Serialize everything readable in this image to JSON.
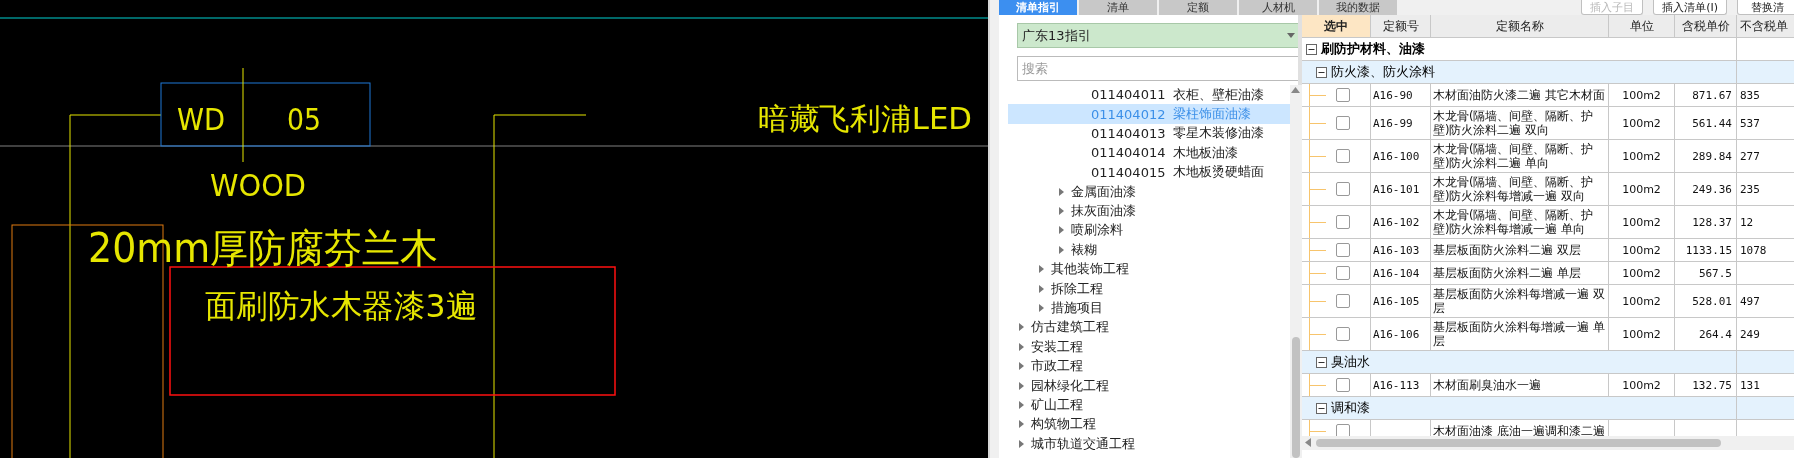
{
  "cad_drawing": {
    "labels": [
      "WD",
      "05",
      "WOOD",
      "20mm厚防腐芬兰木",
      "面刷防水木器漆3遍",
      "暗藏飞利浦LED"
    ]
  },
  "tabs": [
    {
      "label": "清单指引",
      "selected": true
    },
    {
      "label": "清单",
      "selected": false
    },
    {
      "label": "定额",
      "selected": false
    },
    {
      "label": "人材机",
      "selected": false
    },
    {
      "label": "我的数据",
      "selected": false
    }
  ],
  "toolbar_buttons": [
    {
      "label": "插入子目",
      "disabled": true
    },
    {
      "label": "插入清单(I)",
      "disabled": false
    },
    {
      "label": "替换清",
      "disabled": false
    }
  ],
  "guide_panel": {
    "dropdown": "广东13指引",
    "search_placeholder": "搜索",
    "tree": [
      {
        "children": [
          {
            "children": [
              {
                "children": [
                  {
                    "code": "011404011",
                    "label": "衣柜、壁柜油漆",
                    "selected": false
                  },
                  {
                    "code": "011404012",
                    "label": "梁柱饰面油漆",
                    "selected": true
                  },
                  {
                    "code": "011404013",
                    "label": "零星木装修油漆",
                    "selected": false
                  },
                  {
                    "code": "011404014",
                    "label": "木地板油漆",
                    "selected": false
                  },
                  {
                    "code": "011404015",
                    "label": "木地板烫硬蜡面",
                    "selected": false
                  }
                ]
              },
              {
                "label": "金属面油漆",
                "expanded": false,
                "selected": false
              },
              {
                "label": "抹灰面油漆",
                "expanded": false,
                "selected": false
              },
              {
                "label": "喷刷涂料",
                "expanded": false,
                "selected": false
              },
              {
                "label": "裱糊",
                "expanded": false,
                "selected": false
              }
            ]
          },
          {
            "label": "其他装饰工程",
            "expanded": false,
            "selected": false
          },
          {
            "label": "拆除工程",
            "expanded": false,
            "selected": false
          },
          {
            "label": "措施项目",
            "expanded": false,
            "selected": false
          }
        ]
      },
      {
        "label": "仿古建筑工程",
        "expanded": false,
        "selected": false
      },
      {
        "label": "安装工程",
        "expanded": false,
        "selected": false
      },
      {
        "label": "市政工程",
        "expanded": false,
        "selected": false
      },
      {
        "label": "园林绿化工程",
        "expanded": false,
        "selected": false
      },
      {
        "label": "矿山工程",
        "expanded": false,
        "selected": false
      },
      {
        "label": "构筑物工程",
        "expanded": false,
        "selected": false
      },
      {
        "label": "城市轨道交通工程",
        "expanded": false,
        "selected": false
      }
    ]
  },
  "table": {
    "columns": [
      {
        "label": "选中",
        "selected": true
      },
      {
        "label": "定额号",
        "selected": false
      },
      {
        "label": "定额名称",
        "selected": false
      },
      {
        "label": "单位",
        "selected": false
      },
      {
        "label": "含税单价",
        "selected": false
      },
      {
        "label": "不含税单",
        "selected": false
      }
    ],
    "rows": [
      {
        "kind": "group",
        "label": "刷防护材料、油漆",
        "expanded": true,
        "children": [
          {
            "kind": "group",
            "label": "防火漆、防火涂料",
            "expanded": true,
            "children": [
              {
                "kind": "item",
                "checked": false,
                "code": "A16-90",
                "name": "木材面油防火漆二遍 其它木材面",
                "unit": "100m2",
                "price_tax": "871.67",
                "price_notax": "835"
              },
              {
                "kind": "item",
                "checked": false,
                "code": "A16-99",
                "name": "木龙骨(隔墙、间壁、隔断、护壁)防火涂料二遍 双向",
                "unit": "100m2",
                "price_tax": "561.44",
                "price_notax": "537"
              },
              {
                "kind": "item",
                "checked": false,
                "code": "A16-100",
                "name": "木龙骨(隔墙、间壁、隔断、护壁)防火涂料二遍 单向",
                "unit": "100m2",
                "price_tax": "289.84",
                "price_notax": "277"
              },
              {
                "kind": "item",
                "checked": false,
                "code": "A16-101",
                "name": "木龙骨(隔墙、间壁、隔断、护壁)防火涂料每增减一遍 双向",
                "unit": "100m2",
                "price_tax": "249.36",
                "price_notax": "235"
              },
              {
                "kind": "item",
                "checked": false,
                "code": "A16-102",
                "name": "木龙骨(隔墙、间壁、隔断、护壁)防火涂料每增减一遍 单向",
                "unit": "100m2",
                "price_tax": "128.37",
                "price_notax": "12"
              },
              {
                "kind": "item",
                "checked": false,
                "code": "A16-103",
                "name": "基层板面防火涂料二遍 双层",
                "unit": "100m2",
                "price_tax": "1133.15",
                "price_notax": "1078"
              },
              {
                "kind": "item",
                "checked": false,
                "code": "A16-104",
                "name": "基层板面防火涂料二遍 单层",
                "unit": "100m2",
                "price_tax": "567.5"
              },
              {
                "kind": "item",
                "checked": false,
                "code": "A16-105",
                "name": "基层板面防火涂料每增减一遍 双层",
                "unit": "100m2",
                "price_tax": "528.01",
                "price_notax": "497"
              },
              {
                "kind": "item",
                "checked": false,
                "code": "A16-106",
                "name": "基层板面防火涂料每增减一遍 单层",
                "unit": "100m2",
                "price_tax": "264.4",
                "price_notax": "249"
              }
            ]
          },
          {
            "kind": "group",
            "label": "臭油水",
            "expanded": true,
            "children": [
              {
                "kind": "item",
                "checked": false,
                "code": "A16-113",
                "name": "木材面刷臭油水一遍",
                "unit": "100m2",
                "price_tax": "132.75",
                "price_notax": "131"
              }
            ]
          },
          {
            "kind": "group",
            "label": "调和漆",
            "expanded": true,
            "children": [
              {
                "kind": "item",
                "checked": false,
                "name": "木材面油漆 底油一遍调和漆二遍"
              }
            ]
          }
        ]
      }
    ]
  }
}
